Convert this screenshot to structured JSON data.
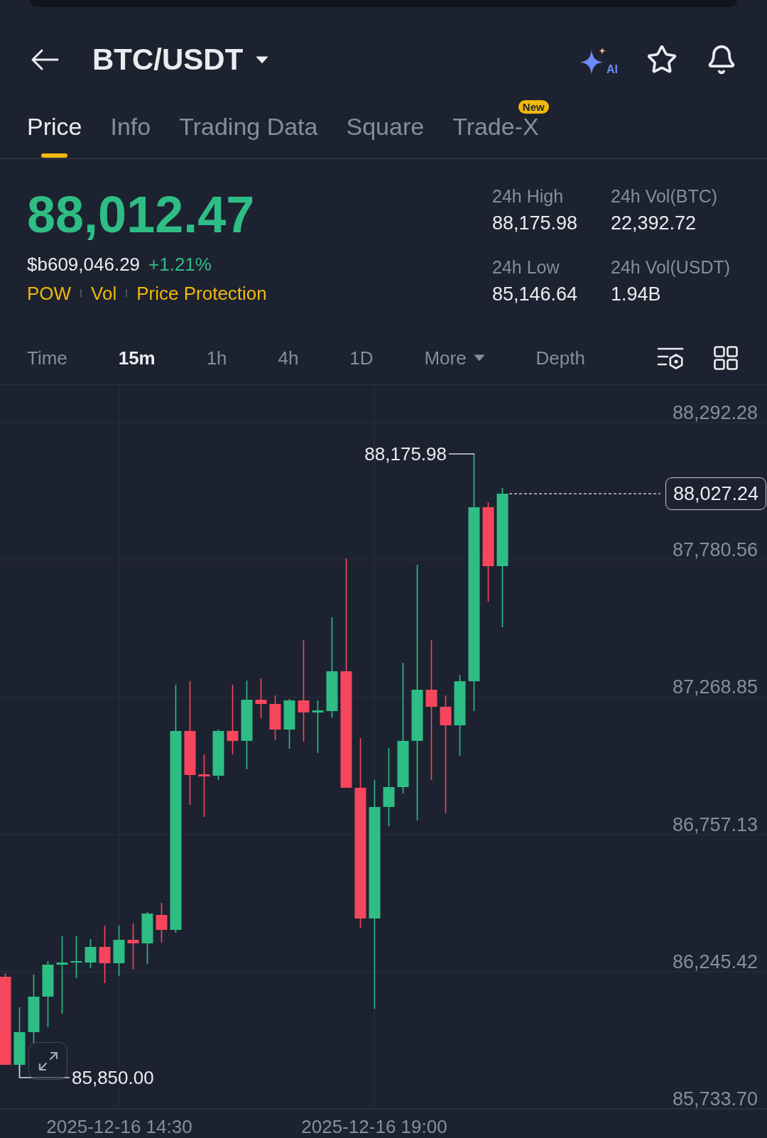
{
  "header": {
    "title": "BTC/USDT",
    "ai_label": "AI"
  },
  "tabs": [
    {
      "label": "Price",
      "selected": true
    },
    {
      "label": "Info",
      "selected": false
    },
    {
      "label": "Trading Data",
      "selected": false
    },
    {
      "label": "Square",
      "selected": false
    },
    {
      "label": "Trade-X",
      "selected": false,
      "badge": "New"
    }
  ],
  "ticker": {
    "price": "88,012.47",
    "converted_price": "$b609,046.29",
    "change": "+1.21%",
    "tags": [
      "POW",
      "Vol",
      "Price Protection"
    ]
  },
  "stats": [
    {
      "label": "24h High",
      "value": "88,175.98"
    },
    {
      "label": "24h Vol(BTC)",
      "value": "22,392.72"
    },
    {
      "label": "24h Low",
      "value": "85,146.64"
    },
    {
      "label": "24h Vol(USDT)",
      "value": "1.94B"
    }
  ],
  "intervals": [
    {
      "label": "Time",
      "selected": false,
      "has_menu": false
    },
    {
      "label": "15m",
      "selected": true,
      "has_menu": false
    },
    {
      "label": "1h",
      "selected": false,
      "has_menu": false
    },
    {
      "label": "4h",
      "selected": false,
      "has_menu": false
    },
    {
      "label": "1D",
      "selected": false,
      "has_menu": false
    },
    {
      "label": "More",
      "selected": false,
      "has_menu": true
    },
    {
      "label": "Depth",
      "selected": false,
      "has_menu": false
    }
  ],
  "chart": {
    "price_axis": [
      "88,292.28",
      "87,780.56",
      "87,268.85",
      "86,757.13",
      "86,245.42",
      "85,733.70"
    ],
    "time_axis": [
      "2025-12-16 14:30",
      "2025-12-16 19:00"
    ],
    "high_label": "88,175.98",
    "low_label": "85,850.00",
    "last_price": "88,027.24"
  }
}
